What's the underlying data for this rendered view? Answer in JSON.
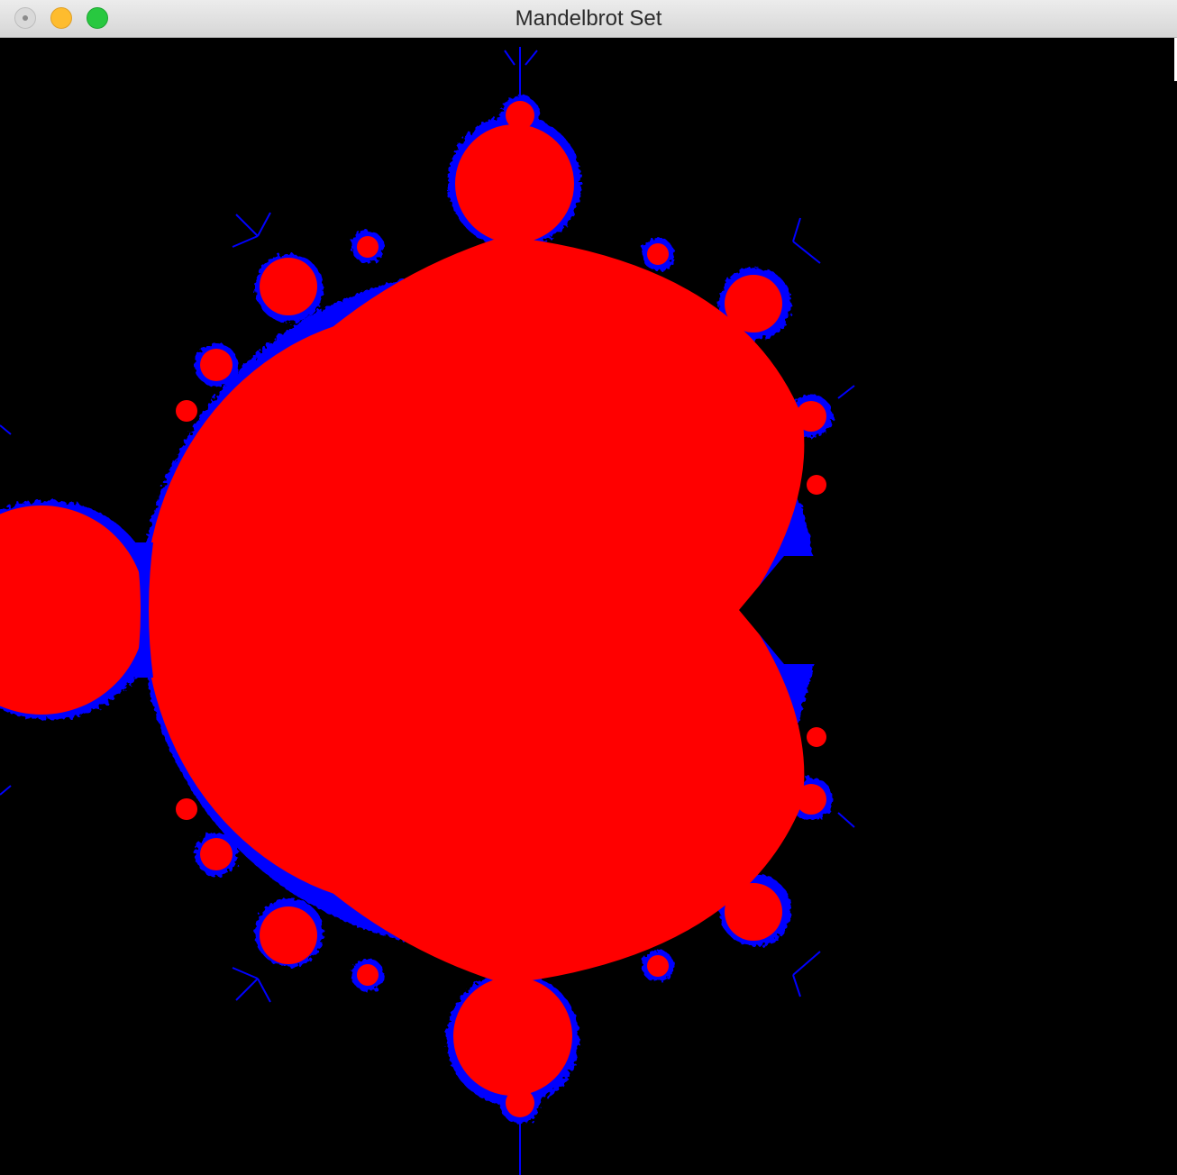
{
  "window": {
    "title": "Mandelbrot Set",
    "controls": {
      "close": "close-icon",
      "minimize": "minimize-icon",
      "maximize": "maximize-icon"
    }
  },
  "colors": {
    "background": "#000000",
    "set_fill": "#ff0000",
    "boundary": "#0000ff",
    "close_button": "#d9d9d9",
    "minimize_button": "#febc2e",
    "maximize_button": "#28c840"
  }
}
